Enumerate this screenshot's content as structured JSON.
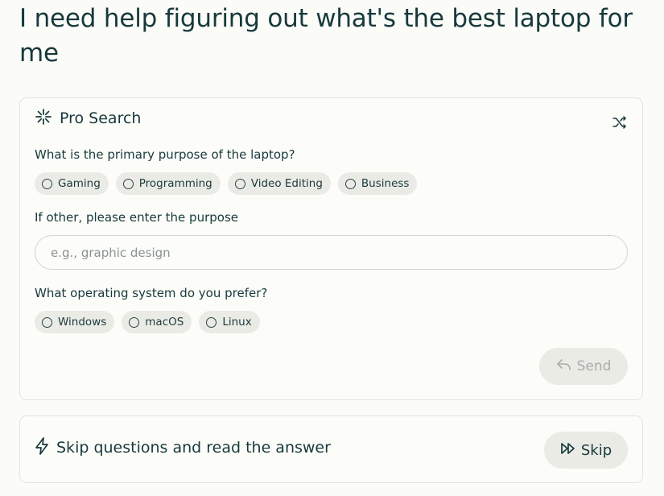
{
  "query": {
    "title": "I need help figuring out what's the best laptop for me"
  },
  "pro_search": {
    "label": "Pro Search",
    "header_icon": "sparkle-icon",
    "shuffle_icon": "shuffle-icon",
    "question_purpose": "What is the primary purpose of the laptop?",
    "purpose_options": [
      "Gaming",
      "Programming",
      "Video Editing",
      "Business"
    ],
    "other_label": "If other, please enter the purpose",
    "other_value": "",
    "other_placeholder": "e.g., graphic design",
    "question_os": "What operating system do you prefer?",
    "os_options": [
      "Windows",
      "macOS",
      "Linux"
    ],
    "send_label": "Send",
    "send_icon": "reply-arrow-icon"
  },
  "skip": {
    "text": "Skip questions and read the answer",
    "icon": "lightning-icon",
    "button_label": "Skip",
    "button_icon": "fast-forward-icon"
  },
  "colors": {
    "text": "#17393b",
    "chip_bg": "#ebebe6",
    "border": "#e3e4df",
    "disabled_text": "#a9adab",
    "background": "#fbfbf8"
  }
}
